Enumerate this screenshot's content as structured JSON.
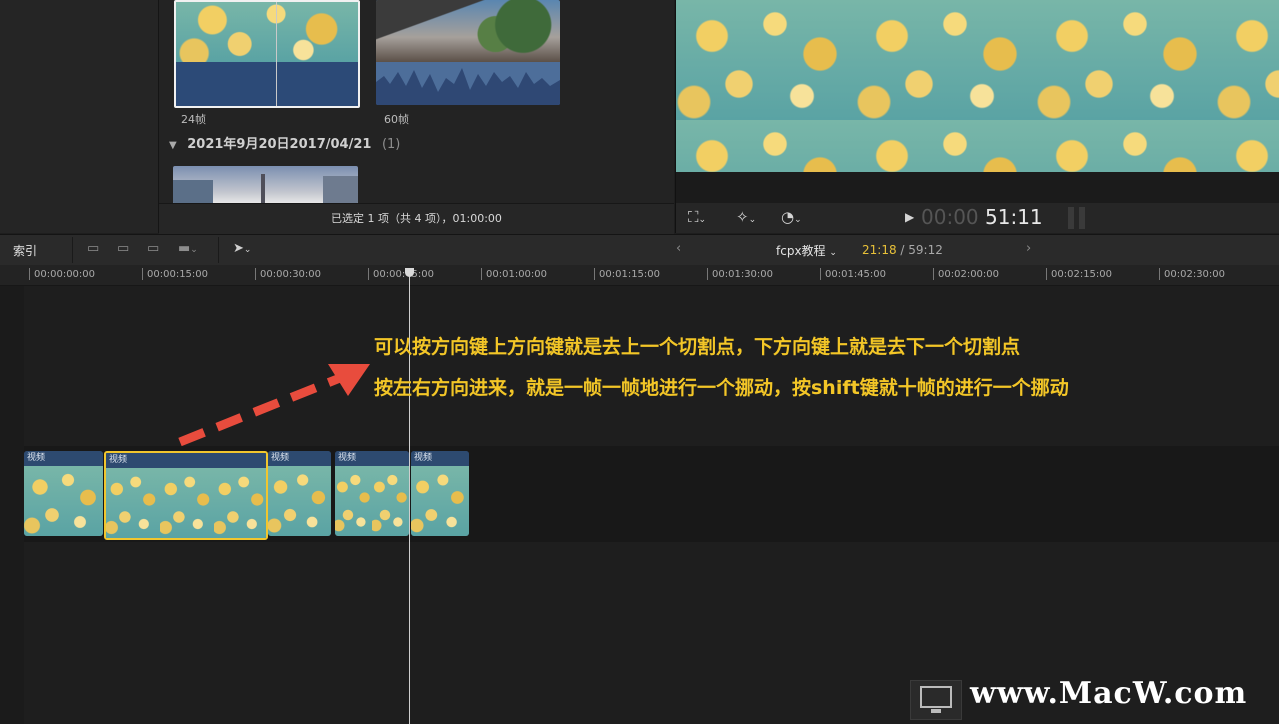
{
  "browser": {
    "clips": [
      {
        "label": "24帧"
      },
      {
        "label": "60帧"
      }
    ],
    "group": {
      "title": "2021年9月20日2017/04/21",
      "count": "(1)"
    },
    "status": "已选定 1 项（共 4 项），01:00:00"
  },
  "viewer": {
    "controls": {
      "transform_icon": "crop-icon",
      "enhance_icon": "magic-wand-icon",
      "speed_icon": "speedometer-icon"
    },
    "timecode": {
      "dim": "00:00",
      "bright": "51:11"
    }
  },
  "timeline": {
    "index_label": "索引",
    "project_name": "fcpx教程",
    "project_current": "21:18",
    "project_total": "/ 59:12",
    "ruler": [
      "00:00:00:00",
      "00:00:15:00",
      "00:00:30:00",
      "00:00:45:00",
      "00:01:00:00",
      "00:01:15:00",
      "00:01:30:00",
      "00:01:45:00",
      "00:02:00:00",
      "00:02:15:00",
      "00:02:30:00"
    ],
    "clip_header": "视频"
  },
  "annotation": {
    "line1": "可以按方向键上方向键就是去上一个切割点，下方向键上就是去下一个切割点",
    "line2": "按左右方向进来，就是一帧一帧地进行一个挪动，按shift键就十帧的进行一个挪动",
    "arrow_color": "#e84c3d",
    "text_color": "#f3c627"
  },
  "watermark": {
    "text": "www.MacW.com"
  }
}
